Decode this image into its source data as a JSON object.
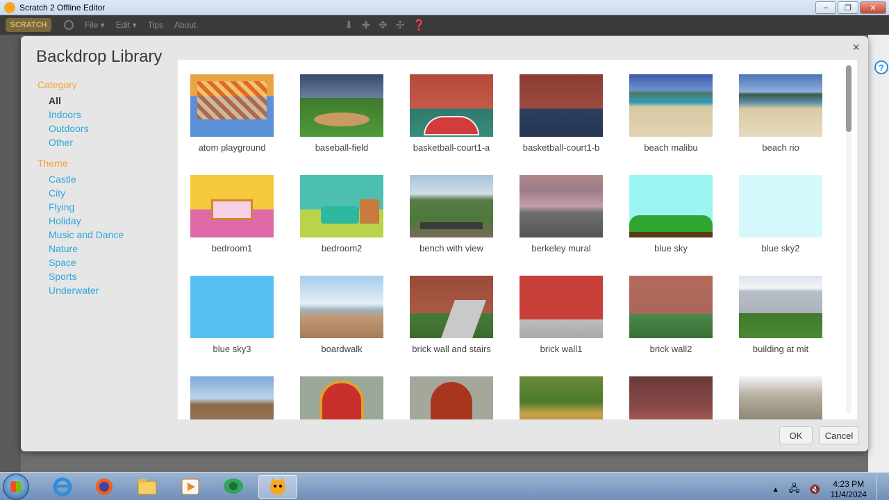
{
  "window": {
    "title": "Scratch 2 Offline Editor",
    "min": "–",
    "max": "❐",
    "close": "✕"
  },
  "menubar": {
    "logo": "SCRATCH",
    "items": [
      "File ▾",
      "Edit ▾",
      "Tips",
      "About"
    ]
  },
  "dialog": {
    "title": "Backdrop Library",
    "close": "×",
    "category_heading": "Category",
    "categories": [
      "All",
      "Indoors",
      "Outdoors",
      "Other"
    ],
    "theme_heading": "Theme",
    "themes": [
      "Castle",
      "City",
      "Flying",
      "Holiday",
      "Music and Dance",
      "Nature",
      "Space",
      "Sports",
      "Underwater"
    ],
    "ok_label": "OK",
    "cancel_label": "Cancel"
  },
  "backdrops": [
    {
      "label": "atom playground"
    },
    {
      "label": "baseball-field"
    },
    {
      "label": "basketball-court1-a"
    },
    {
      "label": "basketball-court1-b"
    },
    {
      "label": "beach malibu"
    },
    {
      "label": "beach rio"
    },
    {
      "label": "bedroom1"
    },
    {
      "label": "bedroom2"
    },
    {
      "label": "bench with view"
    },
    {
      "label": "berkeley mural"
    },
    {
      "label": "blue sky"
    },
    {
      "label": "blue sky2"
    },
    {
      "label": "blue sky3"
    },
    {
      "label": "boardwalk"
    },
    {
      "label": "brick wall and stairs"
    },
    {
      "label": "brick wall1"
    },
    {
      "label": "brick wall2"
    },
    {
      "label": "building at mit"
    },
    {
      "label": ""
    },
    {
      "label": ""
    },
    {
      "label": ""
    },
    {
      "label": ""
    },
    {
      "label": ""
    },
    {
      "label": ""
    }
  ],
  "taskbar": {
    "time": "4:23 PM",
    "date": "11/4/2024"
  }
}
